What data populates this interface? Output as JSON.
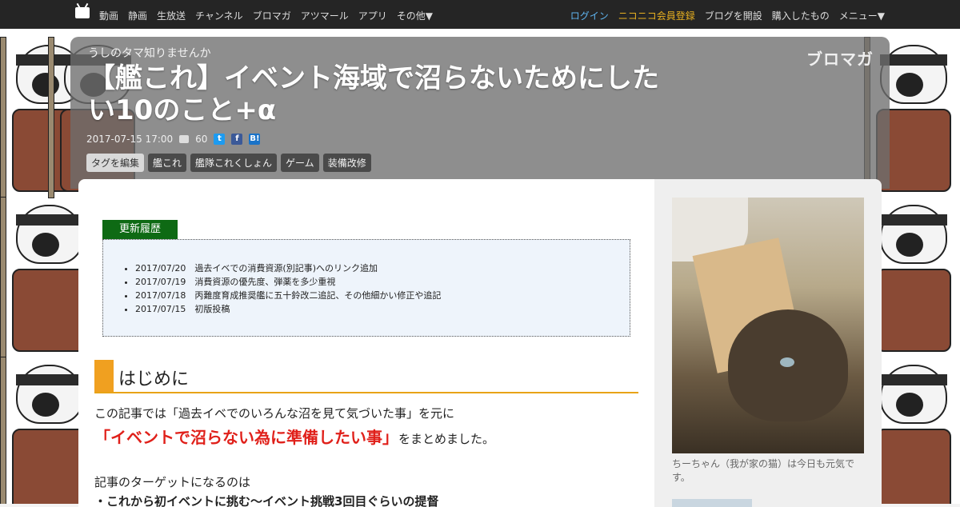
{
  "nav": {
    "left": [
      "動画",
      "静画",
      "生放送",
      "チャンネル",
      "ブロマガ",
      "アツマール",
      "アプリ",
      "その他▼"
    ],
    "right": {
      "login": "ログイン",
      "premium": "ニコニコ会員登録",
      "blog": "ブログを開設",
      "purchased": "購入したもの",
      "menu": "メニュー▼"
    }
  },
  "header": {
    "blog_name": "うしのタマ知りませんか",
    "logo_text": "ブロマガ",
    "title": "【艦これ】イベント海域で沼らないためにしたい10のこと+α",
    "date": "2017-07-15 17:00",
    "comment_count": "60",
    "tags_edit": "タグを編集",
    "tags": [
      "艦これ",
      "艦隊これくしょん",
      "ゲーム",
      "装備改修"
    ]
  },
  "history": {
    "label": "更新履歴",
    "items": [
      "2017/07/20　過去イベでの消費資源(別記事)へのリンク追加",
      "2017/07/19　消費資源の優先度、弾薬を多少重視",
      "2017/07/18　丙難度育成推奨艦に五十鈴改二追記、その他細かい修正や追記",
      "2017/07/15　初版投稿"
    ]
  },
  "article": {
    "heading": "はじめに",
    "p1": "この記事では「過去イベでのいろんな沼を見て気づいた事」を元に",
    "p2_red": "「イベントで沼らない為に準備したい事」",
    "p2_rest": "をまとめました。",
    "p3": "記事のターゲットになるのは",
    "p4": "・これから初イベントに挑む～イベント挑戦3回目ぐらいの提督"
  },
  "sidebar": {
    "caption": "ちーちゃん（我が家の猫）は今日も元気です。"
  },
  "colors": {
    "topbar": "#252525",
    "accent_orange": "#f0a020",
    "history_green": "#0e6a14",
    "emphasis_red": "#e0201a"
  }
}
